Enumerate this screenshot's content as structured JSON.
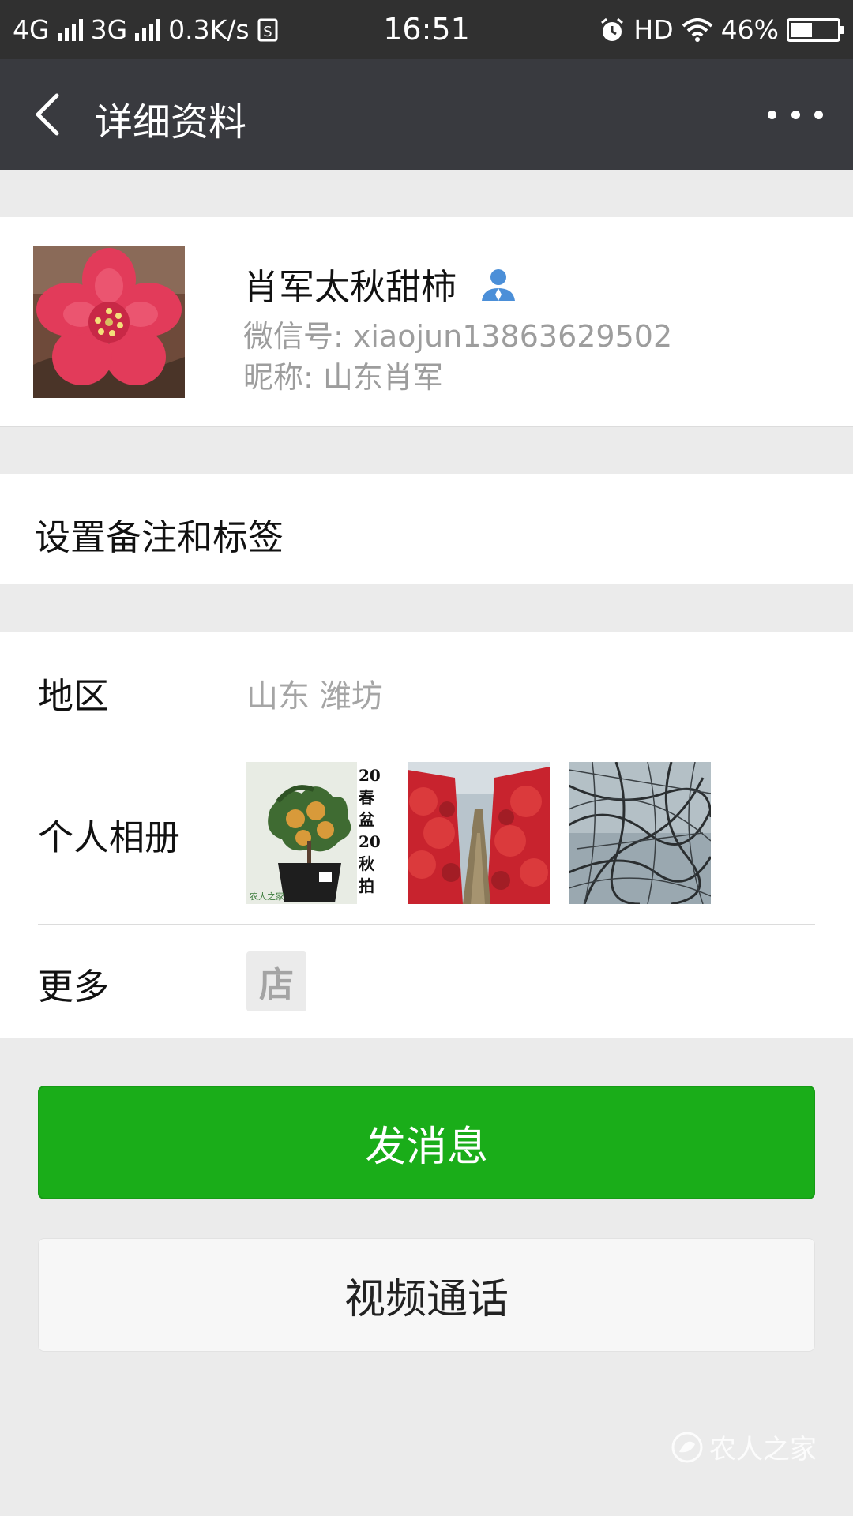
{
  "status_bar": {
    "net1": "4G",
    "net2": "3G",
    "speed": "0.3K/s",
    "time": "16:51",
    "hd": "HD",
    "battery": "46%",
    "battery_level": 0.46
  },
  "nav": {
    "title": "详细资料"
  },
  "profile": {
    "name": "肖军太秋甜柿",
    "wechat_id": "微信号: xiaojun13863629502",
    "nickname": "昵称: 山东肖军"
  },
  "remark": {
    "label": "设置备注和标签"
  },
  "details": {
    "region_label": "地区",
    "region_value": "山东  潍坊",
    "album_label": "个人相册",
    "more_label": "更多",
    "shop_icon_text": "店",
    "album_photo_text": [
      "20",
      "春",
      "盆",
      "20",
      "秋",
      "拍"
    ],
    "album_photo_caption": "农人之家"
  },
  "buttons": {
    "send_message": "发消息",
    "video_call": "视频通话"
  },
  "watermark": {
    "text": "农人之家"
  },
  "colors": {
    "status_bar_bg": "#303030",
    "nav_bg": "#393a3f",
    "page_bg": "#ebebeb",
    "primary_green": "#1aad19",
    "secondary_text": "#9d9d9d",
    "user_icon_blue": "#4b8fd8"
  },
  "icons": {
    "back": "chevron-left-icon",
    "more": "more-dots-icon",
    "contact_type": "user-icon",
    "shop": "shop-icon",
    "alarm": "alarm-icon",
    "wifi": "wifi-icon"
  }
}
